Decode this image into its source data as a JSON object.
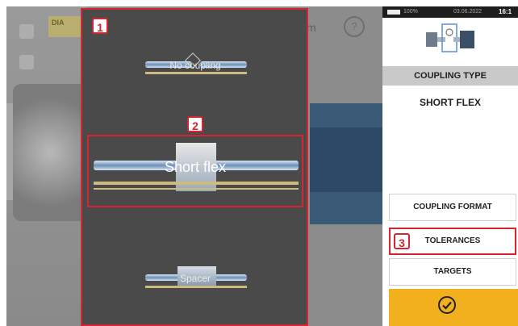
{
  "background": {
    "diagnosis_label": "DIA",
    "m_text": "m",
    "help_symbol": "?"
  },
  "selector": {
    "badges": [
      "1",
      "2",
      "3"
    ],
    "couplings": [
      {
        "label": "No coupling"
      },
      {
        "label": "Short flex"
      },
      {
        "label": "Spacer"
      }
    ]
  },
  "status_bar": {
    "battery": "100%",
    "date": "03.06.2022",
    "time": "16:1"
  },
  "sidebar": {
    "header": "COUPLING TYPE",
    "current_value": "SHORT FLEX",
    "buttons": [
      "COUPLING FORMAT",
      "TOLERANCES",
      "TARGETS"
    ]
  },
  "icons": [
    "home-icon",
    "machine-icon",
    "help-icon",
    "checkmark-icon",
    "battery-icon"
  ],
  "colors": {
    "highlight_red": "#d7242e",
    "confirm_yellow": "#f2b01e",
    "header_gray": "#c9c9c9"
  }
}
